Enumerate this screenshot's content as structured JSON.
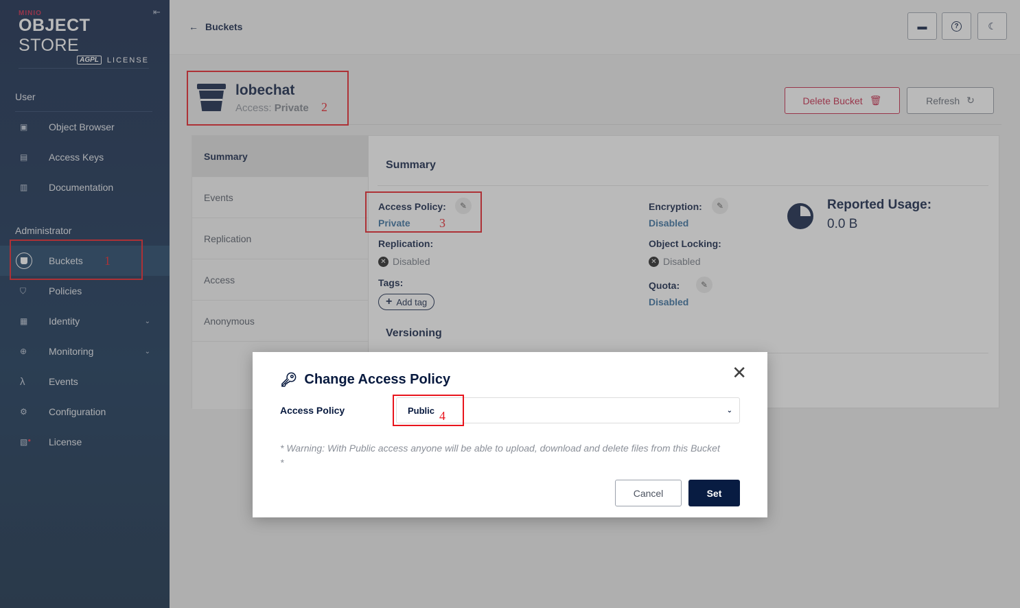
{
  "sidebar": {
    "logo": {
      "brand": "MINIO",
      "product_bold": "OBJECT",
      "product_light": "STORE",
      "license_badge": "AGPL",
      "license": "LICENSE"
    },
    "sections": {
      "user": "User",
      "admin": "Administrator"
    },
    "user_items": [
      {
        "label": "Object Browser",
        "icon": "object-browser-icon"
      },
      {
        "label": "Access Keys",
        "icon": "access-keys-icon"
      },
      {
        "label": "Documentation",
        "icon": "documentation-icon"
      }
    ],
    "admin_items": [
      {
        "label": "Buckets",
        "icon": "bucket-icon",
        "active": true
      },
      {
        "label": "Policies",
        "icon": "shield-icon"
      },
      {
        "label": "Identity",
        "icon": "identity-icon",
        "expandable": true
      },
      {
        "label": "Monitoring",
        "icon": "monitoring-icon",
        "expandable": true
      },
      {
        "label": "Events",
        "icon": "lambda-icon"
      },
      {
        "label": "Configuration",
        "icon": "gear-icon"
      },
      {
        "label": "License",
        "icon": "license-icon"
      }
    ]
  },
  "header": {
    "back_label": "Buckets"
  },
  "bucket": {
    "name": "lobechat",
    "access_prefix": "Access:",
    "access_value": "Private",
    "delete_label": "Delete Bucket",
    "refresh_label": "Refresh"
  },
  "tabs": [
    "Summary",
    "Events",
    "Replication",
    "Access",
    "Anonymous"
  ],
  "summary": {
    "title": "Summary",
    "access_policy_label": "Access Policy:",
    "access_policy_value": "Private",
    "replication_label": "Replication:",
    "replication_value": "Disabled",
    "tags_label": "Tags:",
    "add_tag_label": "Add tag",
    "encryption_label": "Encryption:",
    "encryption_value": "Disabled",
    "object_locking_label": "Object Locking:",
    "object_locking_value": "Disabled",
    "quota_label": "Quota:",
    "quota_value": "Disabled",
    "usage_title": "Reported Usage:",
    "usage_value": "0.0 B",
    "versioning_title": "Versioning"
  },
  "modal": {
    "title": "Change Access Policy",
    "field_label": "Access Policy",
    "selected_value": "Public",
    "warning": "* Warning: With Public access anyone will be able to upload, download and delete files from this Bucket *",
    "cancel_label": "Cancel",
    "set_label": "Set"
  },
  "annotations": [
    "1",
    "2",
    "3",
    "4"
  ],
  "colors": {
    "navy": "#081c42",
    "danger": "#c51b3f",
    "link": "#2f6a9b",
    "annotation": "#e8141c"
  }
}
